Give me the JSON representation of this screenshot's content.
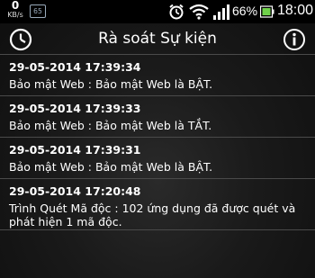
{
  "status_bar": {
    "net_speed_value": "0",
    "net_speed_unit": "KB/s",
    "sim_label": "65",
    "battery_percent": "66%",
    "time": "18:00",
    "icons": [
      "alarm-icon",
      "wifi-icon",
      "signal-icon",
      "battery-icon"
    ]
  },
  "action_bar": {
    "title": "Rà soát Sự kiện",
    "left_icon": "history-clock-icon",
    "right_icon": "info-icon"
  },
  "events": [
    {
      "time": "29-05-2014 17:39:34",
      "message": "Bảo mật Web : Bảo mật Web là BẬT."
    },
    {
      "time": "29-05-2014 17:39:33",
      "message": "Bảo mật Web : Bảo mật Web là TẮT."
    },
    {
      "time": "29-05-2014 17:39:31",
      "message": "Bảo mật Web : Bảo mật Web là BẬT."
    },
    {
      "time": "29-05-2014 17:20:48",
      "message": "Trình Quét Mã độc : 102 ứng dụng đã được quét và phát hiện 1 mã độc."
    }
  ],
  "colors": {
    "status_bar_bg": "#000000",
    "background": "#1a1a1a",
    "divider": "#4a4a4a",
    "text": "#ffffff"
  }
}
